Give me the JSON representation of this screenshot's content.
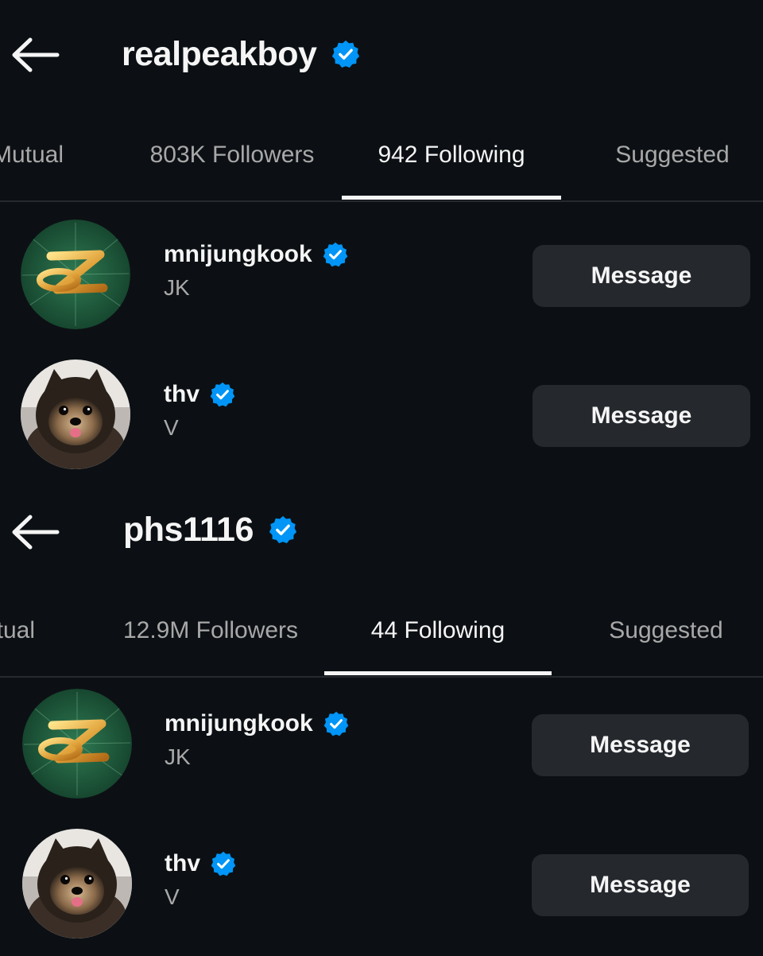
{
  "panels": [
    {
      "username": "realpeakboy",
      "tabs": [
        {
          "label": "Mutual"
        },
        {
          "label": "803K Followers"
        },
        {
          "label": "942 Following",
          "active": true
        },
        {
          "label": "Suggested"
        }
      ],
      "users": [
        {
          "handle": "mnijungkook",
          "name": "JK",
          "avatar": "golden-logo-avatar",
          "button": "Message"
        },
        {
          "handle": "thv",
          "name": "V",
          "avatar": "pomeranian-dog-avatar",
          "button": "Message"
        }
      ]
    },
    {
      "username": "phs1116",
      "tabs": [
        {
          "label": "Mutual"
        },
        {
          "label": "12.9M Followers"
        },
        {
          "label": "44 Following",
          "active": true
        },
        {
          "label": "Suggested"
        }
      ],
      "users": [
        {
          "handle": "mnijungkook",
          "name": "JK",
          "avatar": "golden-logo-avatar",
          "button": "Message"
        },
        {
          "handle": "thv",
          "name": "V",
          "avatar": "pomeranian-dog-avatar",
          "button": "Message"
        }
      ]
    }
  ],
  "icons": {
    "back": "arrow-left-icon",
    "verified": "verified-badge-icon"
  },
  "colors": {
    "background": "#0c1014",
    "verified": "#0095f6",
    "button": "#25292e",
    "text_primary": "#f5f5f5",
    "text_secondary": "#a8a8a8"
  }
}
